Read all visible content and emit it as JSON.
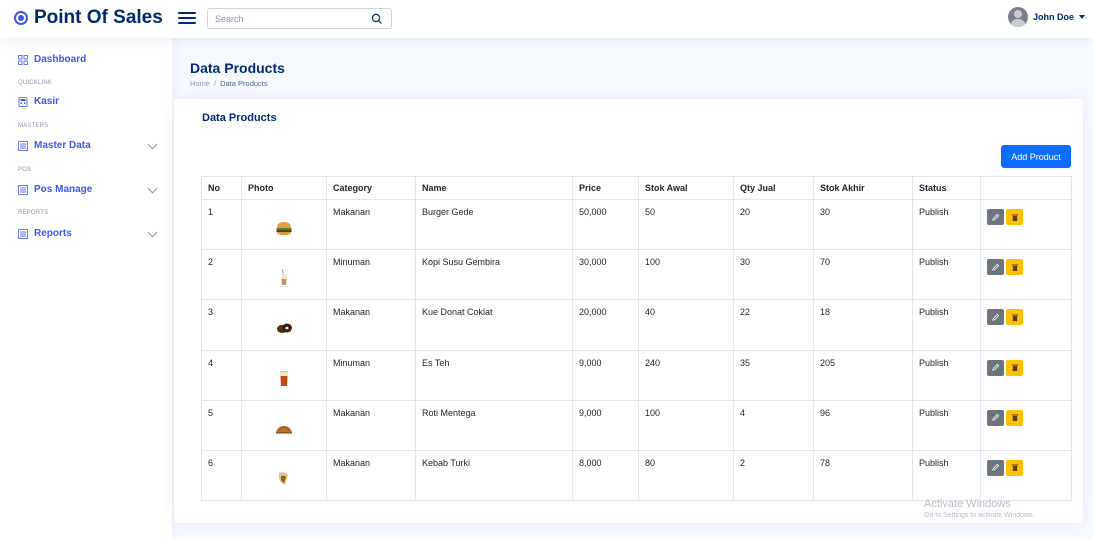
{
  "app": {
    "title": "Point Of Sales"
  },
  "header": {
    "search": {
      "placeholder": "Search"
    },
    "user": {
      "name": "John Doe"
    }
  },
  "sidebar": {
    "dashboard": "Dashboard",
    "heading_quicklink": "QUICKLINK",
    "kasir": "Kasir",
    "heading_masters": "MASTERS",
    "master_data": "Master Data",
    "heading_pos": "POS",
    "pos_manage": "Pos Manage",
    "heading_reports": "REPORTS",
    "reports": "Reports"
  },
  "page": {
    "title": "Data Products",
    "breadcrumb": {
      "home": "Home",
      "separator": "/",
      "current": "Data Products"
    }
  },
  "card": {
    "title": "Data Products",
    "add_button": "Add Product"
  },
  "table": {
    "headers": [
      "No",
      "Photo",
      "Category",
      "Name",
      "Price",
      "Stok Awal",
      "Qty Jual",
      "Stok Akhir",
      "Status",
      ""
    ],
    "rows": [
      {
        "no": "1",
        "photo": "burger-image",
        "category": "Makanan",
        "name": "Burger Gede",
        "price": "50,000",
        "stok_awal": "50",
        "qty_jual": "20",
        "stok_akhir": "30",
        "status": "Publish"
      },
      {
        "no": "2",
        "photo": "iced-coffee-image",
        "category": "Minuman",
        "name": "Kopi Susu Gembira",
        "price": "30,000",
        "stok_awal": "100",
        "qty_jual": "30",
        "stok_akhir": "70",
        "status": "Publish"
      },
      {
        "no": "3",
        "photo": "donut-image",
        "category": "Makanan",
        "name": "Kue Donat Coklat",
        "price": "20,000",
        "stok_awal": "40",
        "qty_jual": "22",
        "stok_akhir": "18",
        "status": "Publish"
      },
      {
        "no": "4",
        "photo": "iced-tea-image",
        "category": "Minuman",
        "name": "Es Teh",
        "price": "9,000",
        "stok_awal": "240",
        "qty_jual": "35",
        "stok_akhir": "205",
        "status": "Publish"
      },
      {
        "no": "5",
        "photo": "bread-image",
        "category": "Makanan",
        "name": "Roti Mentega",
        "price": "9,000",
        "stok_awal": "100",
        "qty_jual": "4",
        "stok_akhir": "96",
        "status": "Publish"
      },
      {
        "no": "6",
        "photo": "kebab-image",
        "category": "Makanan",
        "name": "Kebab Turki",
        "price": "8,000",
        "stok_awal": "80",
        "qty_jual": "2",
        "stok_akhir": "78",
        "status": "Publish"
      }
    ]
  },
  "watermark": {
    "line1": "Activate Windows",
    "line2": "Go to Settings to activate Windows."
  },
  "colors": {
    "primary": "#4154f1",
    "navy": "#012970",
    "button_blue": "#0d6efd",
    "edit_gray": "#6c757d",
    "delete_yellow": "#ffc107",
    "background": "#f6f9ff"
  }
}
